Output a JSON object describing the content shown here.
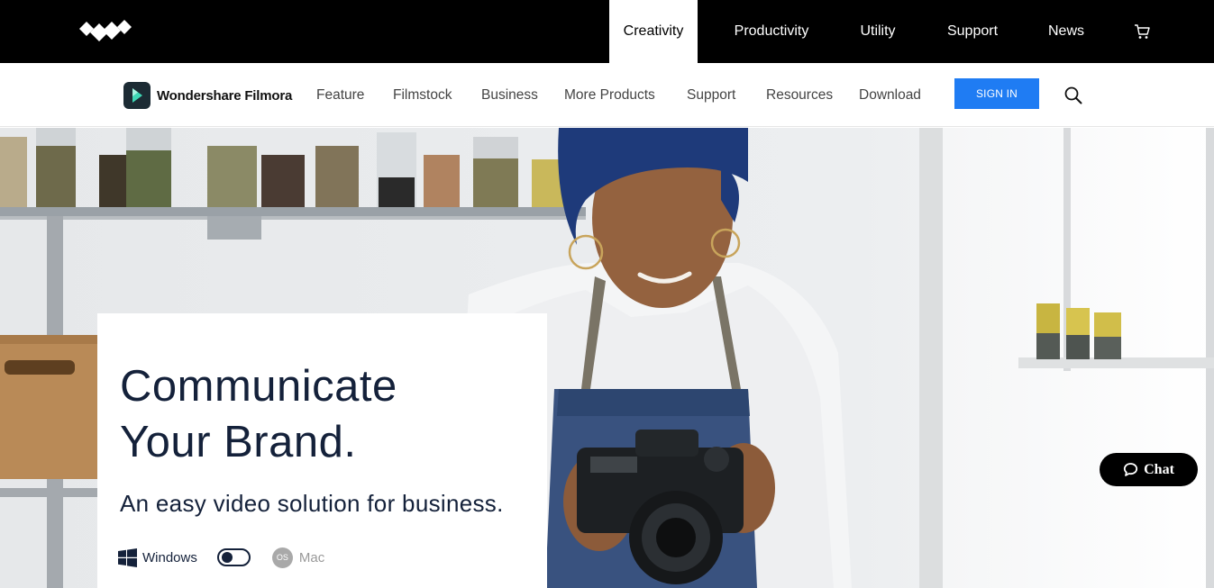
{
  "top_nav": {
    "items": [
      {
        "label": "Creativity",
        "active": true
      },
      {
        "label": "Productivity",
        "active": false
      },
      {
        "label": "Utility",
        "active": false
      },
      {
        "label": "Support",
        "active": false
      },
      {
        "label": "News",
        "active": false
      }
    ],
    "logo_icon": "wondershare-logo-icon",
    "cart_icon": "cart-icon"
  },
  "sub_nav": {
    "brand_name": "Wondershare Filmora",
    "items": [
      "Feature",
      "Filmstock",
      "Business",
      "More Products",
      "Support",
      "Resources",
      "Download"
    ],
    "signin_label": "SIGN IN",
    "search_icon": "search-icon"
  },
  "hero": {
    "headline_line1": "Communicate",
    "headline_line2": "Your Brand.",
    "subheadline": "An easy video solution for business.",
    "os_windows": "Windows",
    "os_mac": "Mac",
    "mac_badge": "OS"
  },
  "chat": {
    "label": "Chat"
  },
  "colors": {
    "accent_blue": "#1f7cf3",
    "headline": "#14213a",
    "topbar": "#000000"
  }
}
